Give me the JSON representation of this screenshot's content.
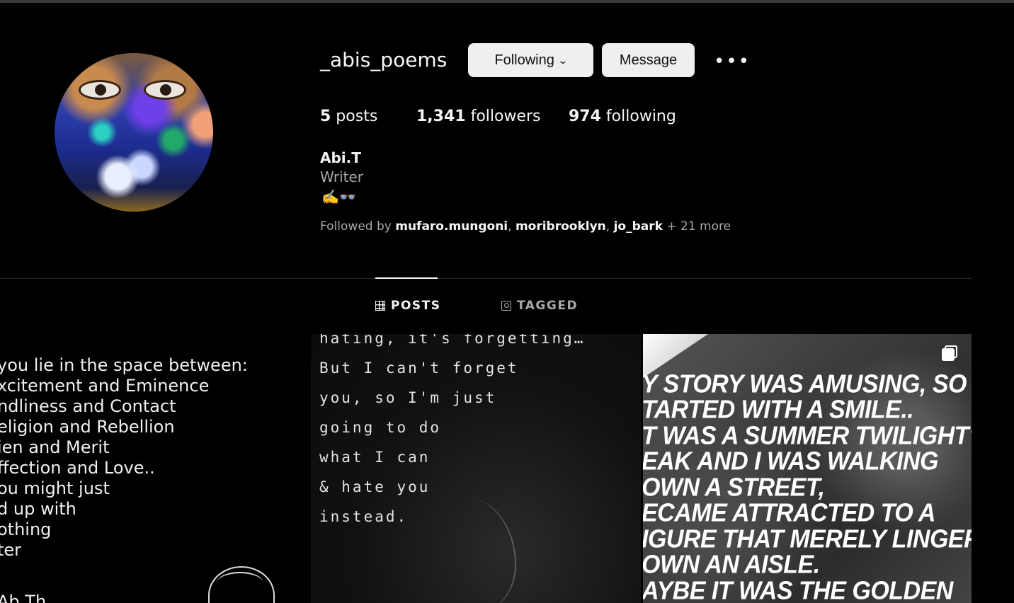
{
  "profile": {
    "username": "_abis_poems",
    "full_name": "Abi.T",
    "bio": "Writer",
    "bio_emoji": "✍️👓",
    "stats": {
      "posts_count": "5",
      "posts_label": " posts",
      "followers_count": "1,341",
      "followers_label": " followers",
      "following_count": "974",
      "following_label": " following"
    },
    "followed_by": {
      "prefix": "Followed by ",
      "names": [
        "mufaro.mungoni",
        "moribrooklyn",
        "jo_bark"
      ],
      "sep": ", ",
      "more": " + 21 more"
    }
  },
  "actions": {
    "following_label": "Following",
    "message_label": "Message",
    "more_label": "•••"
  },
  "tabs": [
    {
      "label": "POSTS",
      "icon": "grid-icon",
      "active": true
    },
    {
      "label": "TAGGED",
      "icon": "tag-icon",
      "active": false
    }
  ],
  "posts": {
    "post1_lines": [
      "you lie in the space between:",
      "xcitement and Eminence",
      "ndliness and Contact",
      "eligion and Rebellion",
      "ien and Merit",
      "ffection and Love..",
      "ou might just",
      "d up with",
      "othing",
      "ter",
      "Ab Th"
    ],
    "post2_lines": [
      "hating, it's forgetting…",
      "But I can't forget",
      "you, so I'm just",
      "going to do",
      "what I can",
      "& hate you",
      "instead."
    ],
    "post3_lines": [
      "Y STORY WAS AMUSING, SO I",
      "TARTED WITH A SMILE..",
      "T WAS A SUMMER TWILIGHT'S",
      "EAK AND I WAS WALKING",
      "OWN A STREET,",
      "ECAME ATTRACTED TO A",
      "IGURE THAT MERELY LINGERE",
      "OWN AN AISLE.",
      "AYBE IT WAS THE GOLDEN"
    ]
  }
}
